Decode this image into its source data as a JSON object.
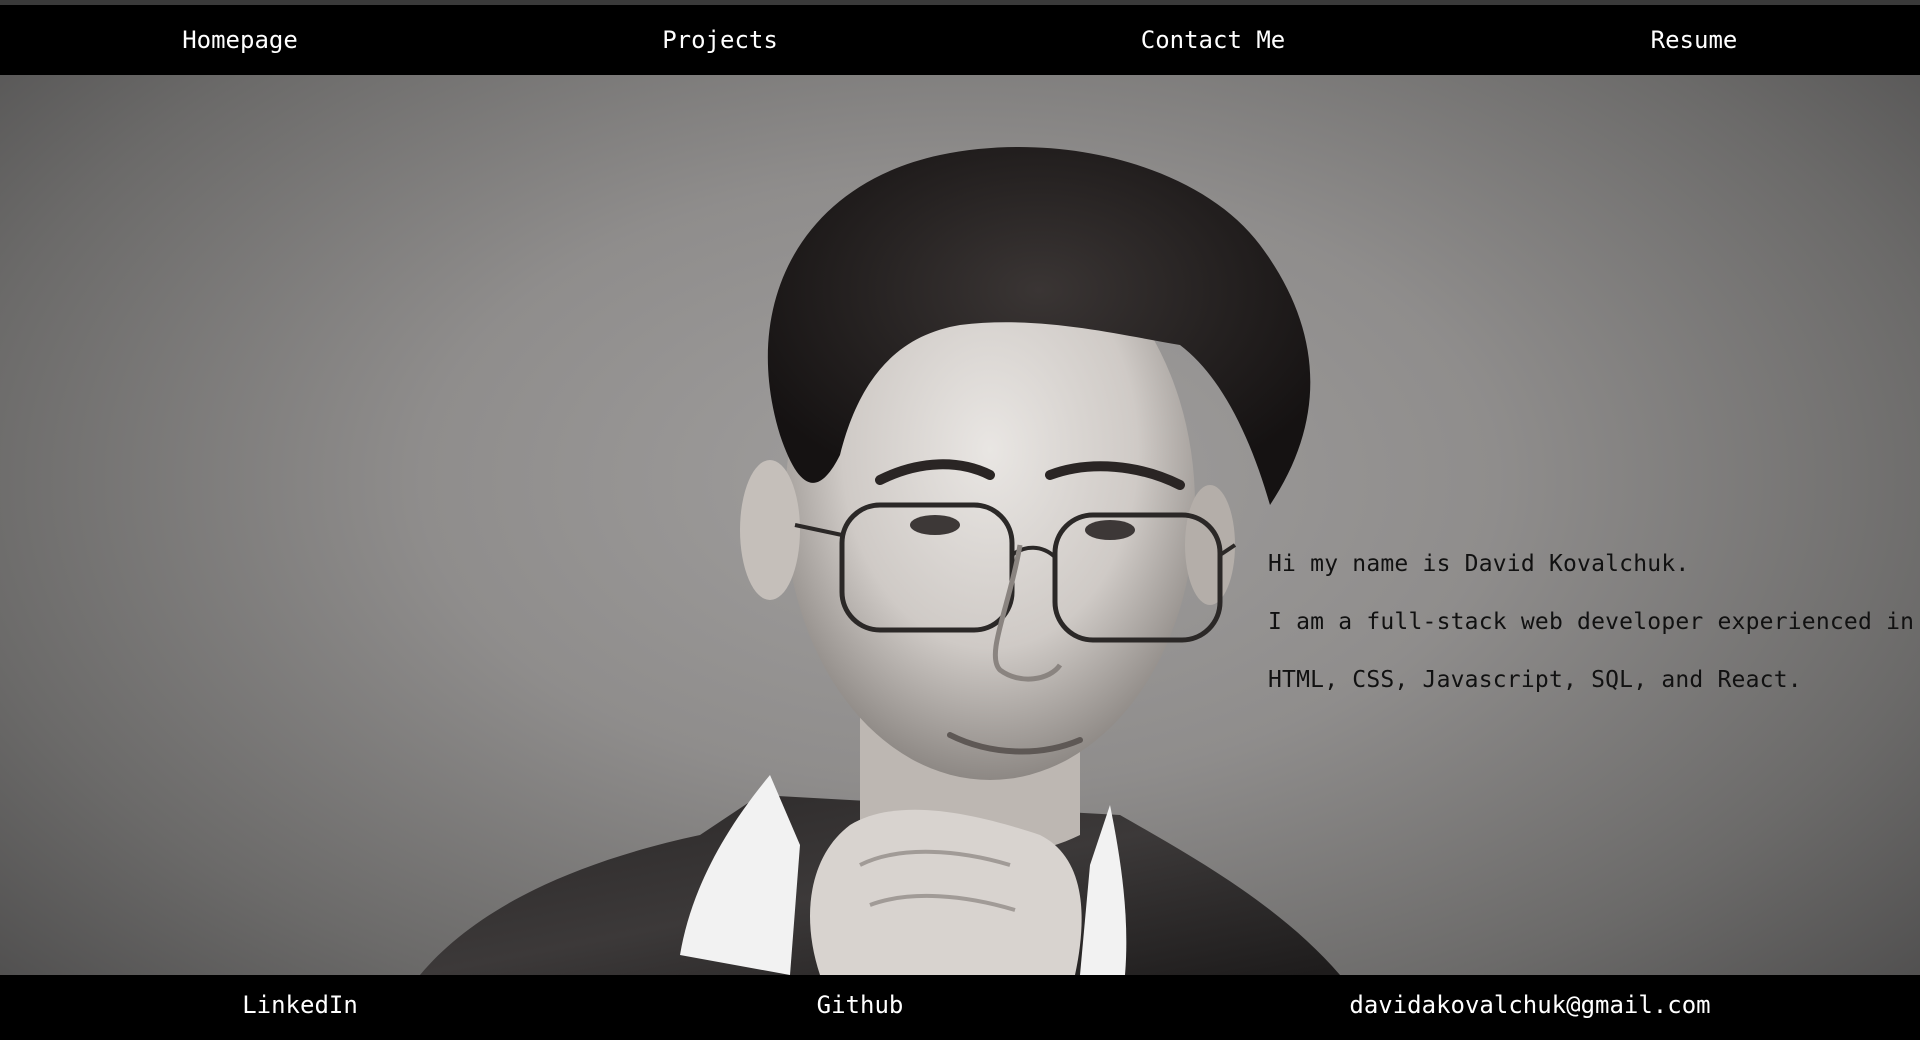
{
  "nav": {
    "items": [
      {
        "label": "Homepage"
      },
      {
        "label": "Projects"
      },
      {
        "label": "Contact Me"
      },
      {
        "label": "Resume"
      }
    ]
  },
  "hero": {
    "portrait_icon": "portrait-photo",
    "intro_lines": [
      "Hi my name is David Kovalchuk.",
      "I am a full-stack web developer experienced in",
      "HTML, CSS, Javascript, SQL, and React."
    ]
  },
  "footer": {
    "links": [
      {
        "label": "LinkedIn"
      },
      {
        "label": "Github"
      },
      {
        "label": "davidakovalchuk@gmail.com"
      }
    ]
  },
  "colors": {
    "bar_background": "#000000",
    "bar_text": "#ffffff",
    "intro_text": "#111111",
    "photo_background": "#9a9897"
  }
}
